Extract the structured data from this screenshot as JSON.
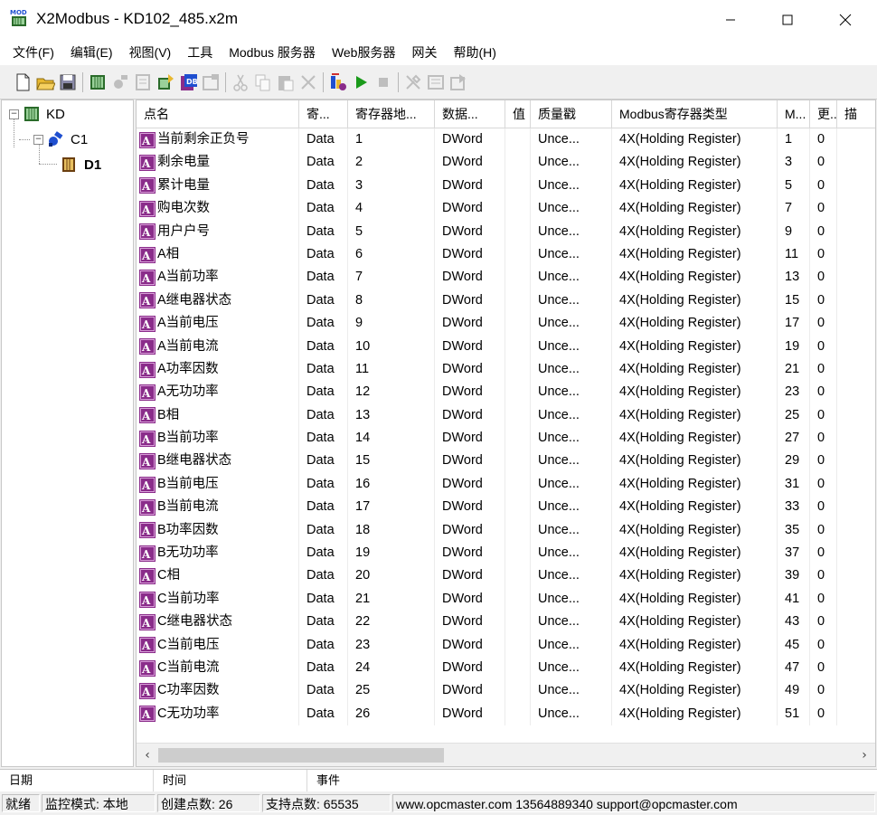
{
  "window": {
    "title": "X2Modbus - KD102_485.x2m"
  },
  "menu": [
    {
      "id": "file",
      "label": "文件(F)"
    },
    {
      "id": "edit",
      "label": "编辑(E)"
    },
    {
      "id": "view",
      "label": "视图(V)"
    },
    {
      "id": "tools",
      "label": "工具"
    },
    {
      "id": "modbus-server",
      "label": "Modbus 服务器"
    },
    {
      "id": "web-server",
      "label": "Web服务器"
    },
    {
      "id": "gateway",
      "label": "网关"
    },
    {
      "id": "help",
      "label": "帮助(H)"
    }
  ],
  "toolbar": [
    {
      "icon": "new-file-icon",
      "enabled": true
    },
    {
      "icon": "open-folder-icon",
      "enabled": true
    },
    {
      "icon": "save-icon",
      "enabled": true
    },
    {
      "sep": true
    },
    {
      "icon": "add-device-icon",
      "enabled": true
    },
    {
      "icon": "add-channel-icon",
      "enabled": false
    },
    {
      "icon": "add-tag-icon",
      "enabled": false
    },
    {
      "icon": "import-icon",
      "enabled": true
    },
    {
      "icon": "db-icon",
      "enabled": true
    },
    {
      "icon": "properties-icon",
      "enabled": false
    },
    {
      "sep": true
    },
    {
      "icon": "cut-icon",
      "enabled": false
    },
    {
      "icon": "copy-icon",
      "enabled": false
    },
    {
      "icon": "paste-icon",
      "enabled": false
    },
    {
      "icon": "delete-icon",
      "enabled": false
    },
    {
      "sep": true
    },
    {
      "icon": "monitor-icon",
      "enabled": true
    },
    {
      "icon": "play-icon",
      "enabled": true
    },
    {
      "icon": "stop-icon",
      "enabled": false
    },
    {
      "sep": true
    },
    {
      "icon": "tools-icon",
      "enabled": false
    },
    {
      "icon": "config-icon",
      "enabled": false
    },
    {
      "icon": "export-icon",
      "enabled": false
    }
  ],
  "tree": {
    "root": "KD",
    "channel": "C1",
    "device": "D1"
  },
  "table": {
    "columns": [
      "点名",
      "寄...",
      "寄存器地...",
      "数据...",
      "值",
      "质量戳",
      "Modbus寄存器类型",
      "M...",
      "更...",
      "描"
    ],
    "rows": [
      {
        "name": "当前剩余正负号",
        "reg": "Data",
        "addr": "1",
        "dtype": "DWord",
        "value": "",
        "quality": "Unce...",
        "mtype": "4X(Holding Register)",
        "m": "1",
        "upd": "0"
      },
      {
        "name": "剩余电量",
        "reg": "Data",
        "addr": "2",
        "dtype": "DWord",
        "value": "",
        "quality": "Unce...",
        "mtype": "4X(Holding Register)",
        "m": "3",
        "upd": "0"
      },
      {
        "name": "累计电量",
        "reg": "Data",
        "addr": "3",
        "dtype": "DWord",
        "value": "",
        "quality": "Unce...",
        "mtype": "4X(Holding Register)",
        "m": "5",
        "upd": "0"
      },
      {
        "name": "购电次数",
        "reg": "Data",
        "addr": "4",
        "dtype": "DWord",
        "value": "",
        "quality": "Unce...",
        "mtype": "4X(Holding Register)",
        "m": "7",
        "upd": "0"
      },
      {
        "name": "用户户号",
        "reg": "Data",
        "addr": "5",
        "dtype": "DWord",
        "value": "",
        "quality": "Unce...",
        "mtype": "4X(Holding Register)",
        "m": "9",
        "upd": "0"
      },
      {
        "name": "A相",
        "reg": "Data",
        "addr": "6",
        "dtype": "DWord",
        "value": "",
        "quality": "Unce...",
        "mtype": "4X(Holding Register)",
        "m": "11",
        "upd": "0"
      },
      {
        "name": "A当前功率",
        "reg": "Data",
        "addr": "7",
        "dtype": "DWord",
        "value": "",
        "quality": "Unce...",
        "mtype": "4X(Holding Register)",
        "m": "13",
        "upd": "0"
      },
      {
        "name": "A继电器状态",
        "reg": "Data",
        "addr": "8",
        "dtype": "DWord",
        "value": "",
        "quality": "Unce...",
        "mtype": "4X(Holding Register)",
        "m": "15",
        "upd": "0"
      },
      {
        "name": "A当前电压",
        "reg": "Data",
        "addr": "9",
        "dtype": "DWord",
        "value": "",
        "quality": "Unce...",
        "mtype": "4X(Holding Register)",
        "m": "17",
        "upd": "0"
      },
      {
        "name": "A当前电流",
        "reg": "Data",
        "addr": "10",
        "dtype": "DWord",
        "value": "",
        "quality": "Unce...",
        "mtype": "4X(Holding Register)",
        "m": "19",
        "upd": "0"
      },
      {
        "name": "A功率因数",
        "reg": "Data",
        "addr": "11",
        "dtype": "DWord",
        "value": "",
        "quality": "Unce...",
        "mtype": "4X(Holding Register)",
        "m": "21",
        "upd": "0"
      },
      {
        "name": "A无功功率",
        "reg": "Data",
        "addr": "12",
        "dtype": "DWord",
        "value": "",
        "quality": "Unce...",
        "mtype": "4X(Holding Register)",
        "m": "23",
        "upd": "0"
      },
      {
        "name": "B相",
        "reg": "Data",
        "addr": "13",
        "dtype": "DWord",
        "value": "",
        "quality": "Unce...",
        "mtype": "4X(Holding Register)",
        "m": "25",
        "upd": "0"
      },
      {
        "name": "B当前功率",
        "reg": "Data",
        "addr": "14",
        "dtype": "DWord",
        "value": "",
        "quality": "Unce...",
        "mtype": "4X(Holding Register)",
        "m": "27",
        "upd": "0"
      },
      {
        "name": "B继电器状态",
        "reg": "Data",
        "addr": "15",
        "dtype": "DWord",
        "value": "",
        "quality": "Unce...",
        "mtype": "4X(Holding Register)",
        "m": "29",
        "upd": "0"
      },
      {
        "name": "B当前电压",
        "reg": "Data",
        "addr": "16",
        "dtype": "DWord",
        "value": "",
        "quality": "Unce...",
        "mtype": "4X(Holding Register)",
        "m": "31",
        "upd": "0"
      },
      {
        "name": "B当前电流",
        "reg": "Data",
        "addr": "17",
        "dtype": "DWord",
        "value": "",
        "quality": "Unce...",
        "mtype": "4X(Holding Register)",
        "m": "33",
        "upd": "0"
      },
      {
        "name": "B功率因数",
        "reg": "Data",
        "addr": "18",
        "dtype": "DWord",
        "value": "",
        "quality": "Unce...",
        "mtype": "4X(Holding Register)",
        "m": "35",
        "upd": "0"
      },
      {
        "name": "B无功功率",
        "reg": "Data",
        "addr": "19",
        "dtype": "DWord",
        "value": "",
        "quality": "Unce...",
        "mtype": "4X(Holding Register)",
        "m": "37",
        "upd": "0"
      },
      {
        "name": "C相",
        "reg": "Data",
        "addr": "20",
        "dtype": "DWord",
        "value": "",
        "quality": "Unce...",
        "mtype": "4X(Holding Register)",
        "m": "39",
        "upd": "0"
      },
      {
        "name": "C当前功率",
        "reg": "Data",
        "addr": "21",
        "dtype": "DWord",
        "value": "",
        "quality": "Unce...",
        "mtype": "4X(Holding Register)",
        "m": "41",
        "upd": "0"
      },
      {
        "name": "C继电器状态",
        "reg": "Data",
        "addr": "22",
        "dtype": "DWord",
        "value": "",
        "quality": "Unce...",
        "mtype": "4X(Holding Register)",
        "m": "43",
        "upd": "0"
      },
      {
        "name": "C当前电压",
        "reg": "Data",
        "addr": "23",
        "dtype": "DWord",
        "value": "",
        "quality": "Unce...",
        "mtype": "4X(Holding Register)",
        "m": "45",
        "upd": "0"
      },
      {
        "name": "C当前电流",
        "reg": "Data",
        "addr": "24",
        "dtype": "DWord",
        "value": "",
        "quality": "Unce...",
        "mtype": "4X(Holding Register)",
        "m": "47",
        "upd": "0"
      },
      {
        "name": "C功率因数",
        "reg": "Data",
        "addr": "25",
        "dtype": "DWord",
        "value": "",
        "quality": "Unce...",
        "mtype": "4X(Holding Register)",
        "m": "49",
        "upd": "0"
      },
      {
        "name": "C无功功率",
        "reg": "Data",
        "addr": "26",
        "dtype": "DWord",
        "value": "",
        "quality": "Unce...",
        "mtype": "4X(Holding Register)",
        "m": "51",
        "upd": "0"
      }
    ]
  },
  "log": {
    "columns": [
      "日期",
      "时间",
      "事件"
    ]
  },
  "status": {
    "ready": "就绪",
    "mode": "监控模式: 本地",
    "created": "创建点数: 26",
    "supported": "支持点数: 65535",
    "contact": "www.opcmaster.com 13564889340 support@opcmaster.com"
  },
  "colors": {
    "tag_icon": "#8a2c8a",
    "play": "#1a9a1a",
    "device_icon": "#2a6b2a",
    "channel_icon": "#1f4fd0"
  }
}
